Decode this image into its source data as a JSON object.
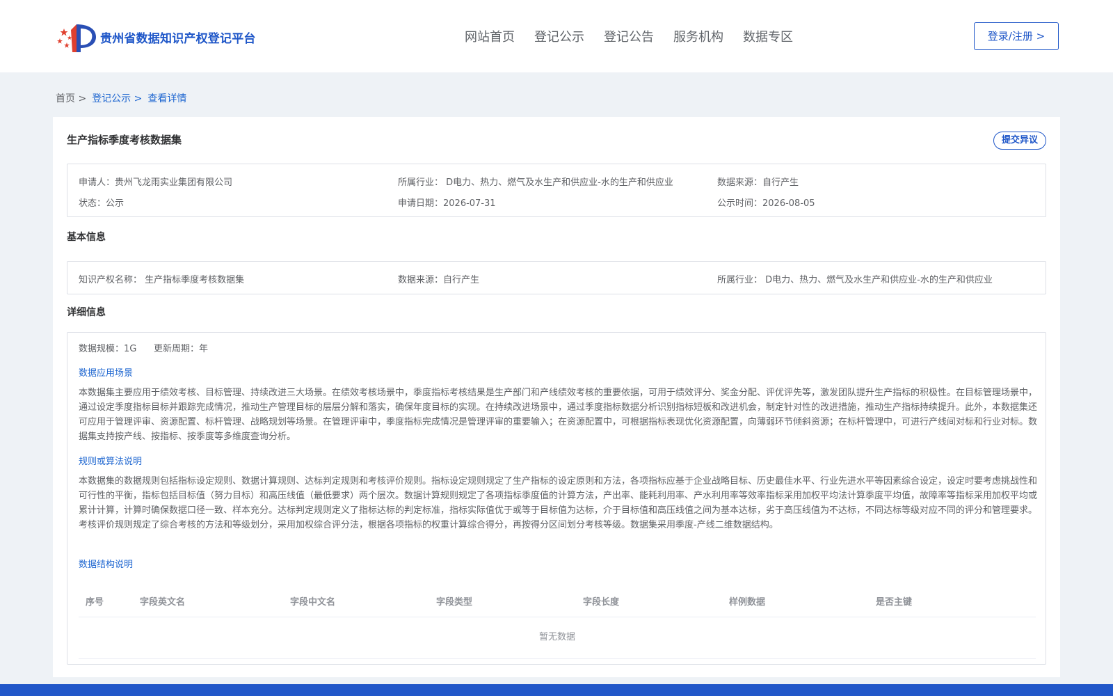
{
  "header": {
    "site_title": "贵州省数据知识产权登记平台",
    "nav": [
      "网站首页",
      "登记公示",
      "登记公告",
      "服务机构",
      "数据专区"
    ],
    "login_label": "登录/注册 >"
  },
  "breadcrumb": [
    "首页 >",
    "登记公示 >",
    "查看详情"
  ],
  "detail": {
    "title": "生产指标季度考核数据集",
    "objection_label": "提交异议",
    "summary": {
      "applicant": "申请人：贵州飞龙雨实业集团有限公司",
      "industry": "所属行业： D电力、热力、燃气及水生产和供应业-水的生产和供应业",
      "source": "数据来源：自行产生",
      "status": "状态：公示",
      "apply_date": "申请日期：2026-07-31",
      "publish_time": "公示时间：2026-08-05"
    },
    "basic_title": "基本信息",
    "basic": {
      "ip_name": "知识产权名称： 生产指标季度考核数据集",
      "source": "数据来源：自行产生",
      "industry": "所属行业： D电力、热力、燃气及水生产和供应业-水的生产和供应业"
    },
    "detail_title": "详细信息",
    "scale": "数据规模：1G",
    "update_cycle": "更新周期：年",
    "scenario_title": "数据应用场景",
    "scenario_text": "本数据集主要应用于绩效考核、目标管理、持续改进三大场景。在绩效考核场景中，季度指标考核结果是生产部门和产线绩效考核的重要依据，可用于绩效评分、奖金分配、评优评先等，激发团队提升生产指标的积极性。在目标管理场景中，通过设定季度指标目标并跟踪完成情况，推动生产管理目标的层层分解和落实，确保年度目标的实现。在持续改进场景中，通过季度指标数据分析识别指标短板和改进机会，制定针对性的改进措施，推动生产指标持续提升。此外，本数据集还可应用于管理评审、资源配置、标杆管理、战略规划等场景。在管理评审中，季度指标完成情况是管理评审的重要输入；在资源配置中，可根据指标表现优化资源配置，向薄弱环节倾斜资源；在标杆管理中，可进行产线间对标和行业对标。数据集支持按产线、按指标、按季度等多维度查询分析。",
    "rules_title": "规则或算法说明",
    "rules_text": "本数据集的数据规则包括指标设定规则、数据计算规则、达标判定规则和考核评价规则。指标设定规则规定了生产指标的设定原则和方法，各项指标应基于企业战略目标、历史最佳水平、行业先进水平等因素综合设定，设定时要考虑挑战性和可行性的平衡，指标包括目标值（努力目标）和高压线值（最低要求）两个层次。数据计算规则规定了各项指标季度值的计算方法，产出率、能耗利用率、产水利用率等效率指标采用加权平均法计算季度平均值，故障率等指标采用加权平均或累计计算，计算时确保数据口径一致、样本充分。达标判定规则定义了指标达标的判定标准，指标实际值优于或等于目标值为达标，介于目标值和高压线值之间为基本达标，劣于高压线值为不达标，不同达标等级对应不同的评分和管理要求。考核评价规则规定了综合考核的方法和等级划分，采用加权综合评分法，根据各项指标的权重计算综合得分，再按得分区间划分考核等级。数据集采用季度-产线二维数据结构。",
    "structure_title": "数据结构说明",
    "table_headers": [
      "序号",
      "字段英文名",
      "字段中文名",
      "字段类型",
      "字段长度",
      "样例数据",
      "是否主键"
    ],
    "table_empty": "暂无数据"
  }
}
